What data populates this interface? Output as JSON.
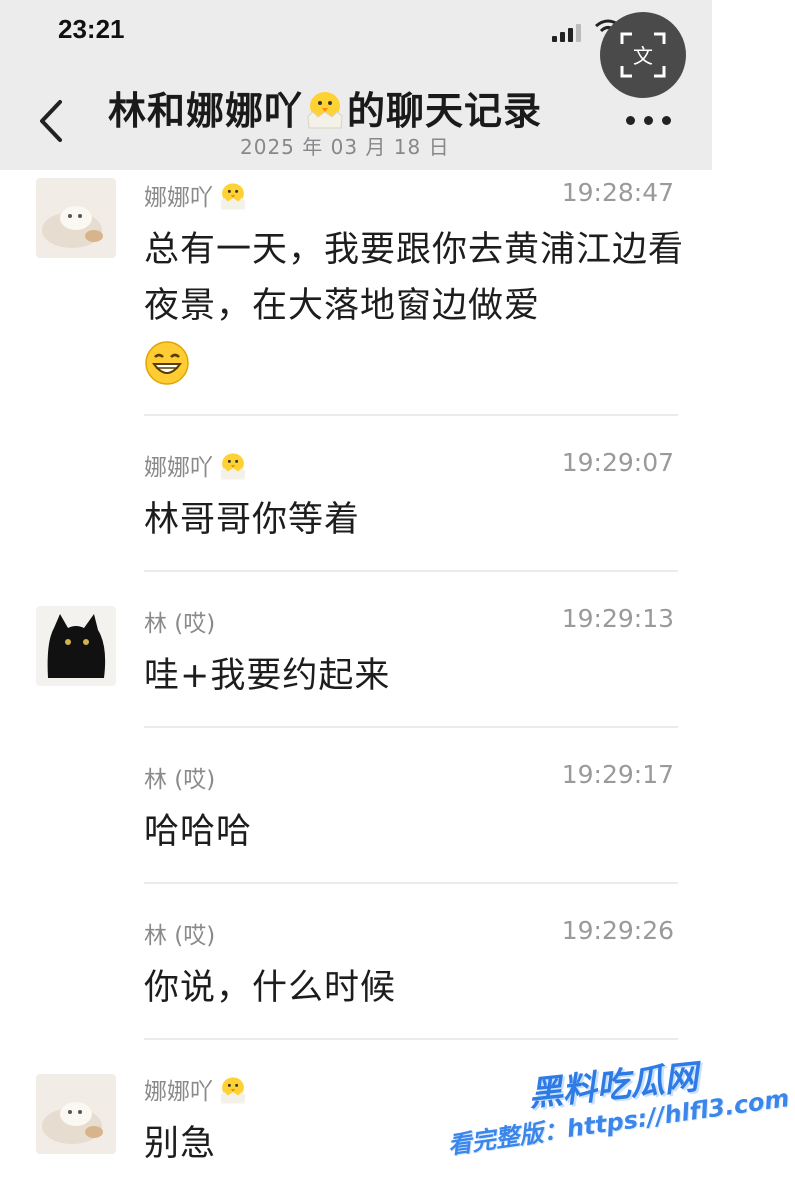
{
  "status_bar": {
    "time": "23:21"
  },
  "header": {
    "title_prefix": "林和娜娜吖",
    "title_suffix": "的聊天记录",
    "date": "2025 年 03 月 18 日",
    "translate_icon_label": "文"
  },
  "messages": [
    {
      "sender": "娜娜吖",
      "sender_emoji": "chick-emoji",
      "time": "19:28:47",
      "text": "总有一天，我要跟你去黄浦江边看夜景，在大落地窗边做爱",
      "trailing_emoji": "grin-emoji",
      "avatar": "cat-plush-avatar"
    },
    {
      "sender": "娜娜吖",
      "sender_emoji": "chick-emoji",
      "time": "19:29:07",
      "text": "林哥哥你等着"
    },
    {
      "sender": "林 (哎)",
      "time": "19:29:13",
      "text": "哇+我要约起来",
      "avatar": "black-cat-avatar"
    },
    {
      "sender": "林 (哎)",
      "time": "19:29:17",
      "text": "哈哈哈"
    },
    {
      "sender": "林 (哎)",
      "time": "19:29:26",
      "text": "你说，什么时候"
    },
    {
      "sender": "娜娜吖",
      "sender_emoji": "chick-emoji",
      "time": "",
      "text": "别急",
      "avatar": "cat-plush-avatar"
    }
  ],
  "watermark": {
    "title": "黑料吃瓜网",
    "url": "看完整版：https://hlfl3.com"
  },
  "colors": {
    "header_bg": "#ececec",
    "text": "#1d1d1d",
    "muted": "#8a8a8a",
    "watermark": "#2e7be6"
  }
}
